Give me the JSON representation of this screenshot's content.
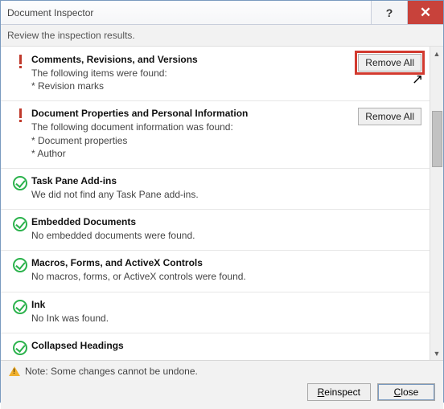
{
  "window": {
    "title": "Document Inspector",
    "help_label": "?",
    "close_label": "✕"
  },
  "subtitle": "Review the inspection results.",
  "sections": [
    {
      "status": "alert",
      "heading": "Comments, Revisions, and Versions",
      "details": [
        "The following items were found:",
        "* Revision marks"
      ],
      "action": "Remove All",
      "highlight": true
    },
    {
      "status": "alert",
      "heading": "Document Properties and Personal Information",
      "details": [
        "The following document information was found:",
        "* Document properties",
        "* Author"
      ],
      "action": "Remove All",
      "highlight": false
    },
    {
      "status": "ok",
      "heading": "Task Pane Add-ins",
      "details": [
        "We did not find any Task Pane add-ins."
      ],
      "action": null
    },
    {
      "status": "ok",
      "heading": "Embedded Documents",
      "details": [
        "No embedded documents were found."
      ],
      "action": null
    },
    {
      "status": "ok",
      "heading": "Macros, Forms, and ActiveX Controls",
      "details": [
        "No macros, forms, or ActiveX controls were found."
      ],
      "action": null
    },
    {
      "status": "ok",
      "heading": "Ink",
      "details": [
        "No Ink was found."
      ],
      "action": null
    },
    {
      "status": "ok",
      "heading": "Collapsed Headings",
      "details": [],
      "action": null
    }
  ],
  "footer": {
    "note": "Note: Some changes cannot be undone.",
    "reinspect": "Reinspect",
    "close": "Close"
  }
}
